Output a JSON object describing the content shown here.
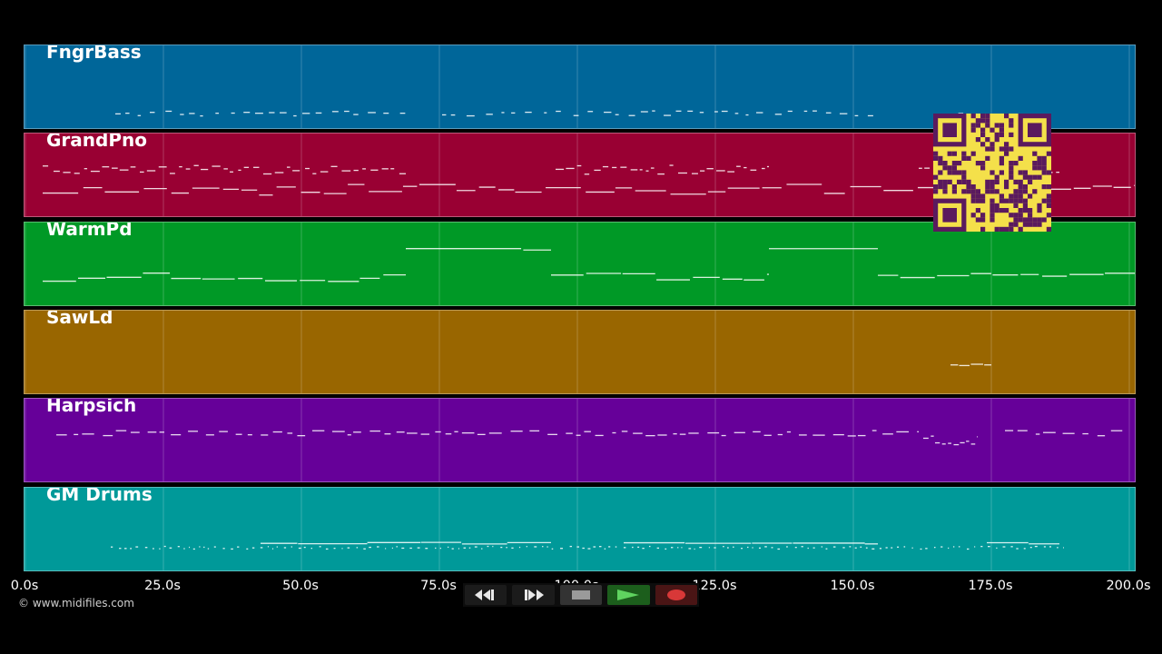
{
  "tracks": [
    {
      "label": "FngrBass",
      "color": "#006699"
    },
    {
      "label": "GrandPno",
      "color": "#990033"
    },
    {
      "label": "WarmPd",
      "color": "#009926"
    },
    {
      "label": "SawLd",
      "color": "#996600"
    },
    {
      "label": "Harpsich",
      "color": "#660099"
    },
    {
      "label": "GM Drums",
      "color": "#009999"
    }
  ],
  "timeline": {
    "ticks": [
      "0.0s",
      "25.0s",
      "50.0s",
      "75.0s",
      "100.0s",
      "125.0s",
      "150.0s",
      "175.0s",
      "200.0s"
    ],
    "tick_values": [
      0,
      25,
      50,
      75,
      100,
      125,
      150,
      175,
      200
    ],
    "range": [
      0,
      200
    ]
  },
  "transport": {
    "rewind_icon": "rewind-icon",
    "fast_forward_icon": "fast-forward-icon",
    "stop_icon": "stop-icon",
    "play_icon": "play-icon",
    "record_icon": "record-icon"
  },
  "copyright": "© www.midifiles.com",
  "qr": {
    "icon": "qr-code-icon",
    "color": "#f4e04a",
    "module_color": "#5a1a5e"
  }
}
